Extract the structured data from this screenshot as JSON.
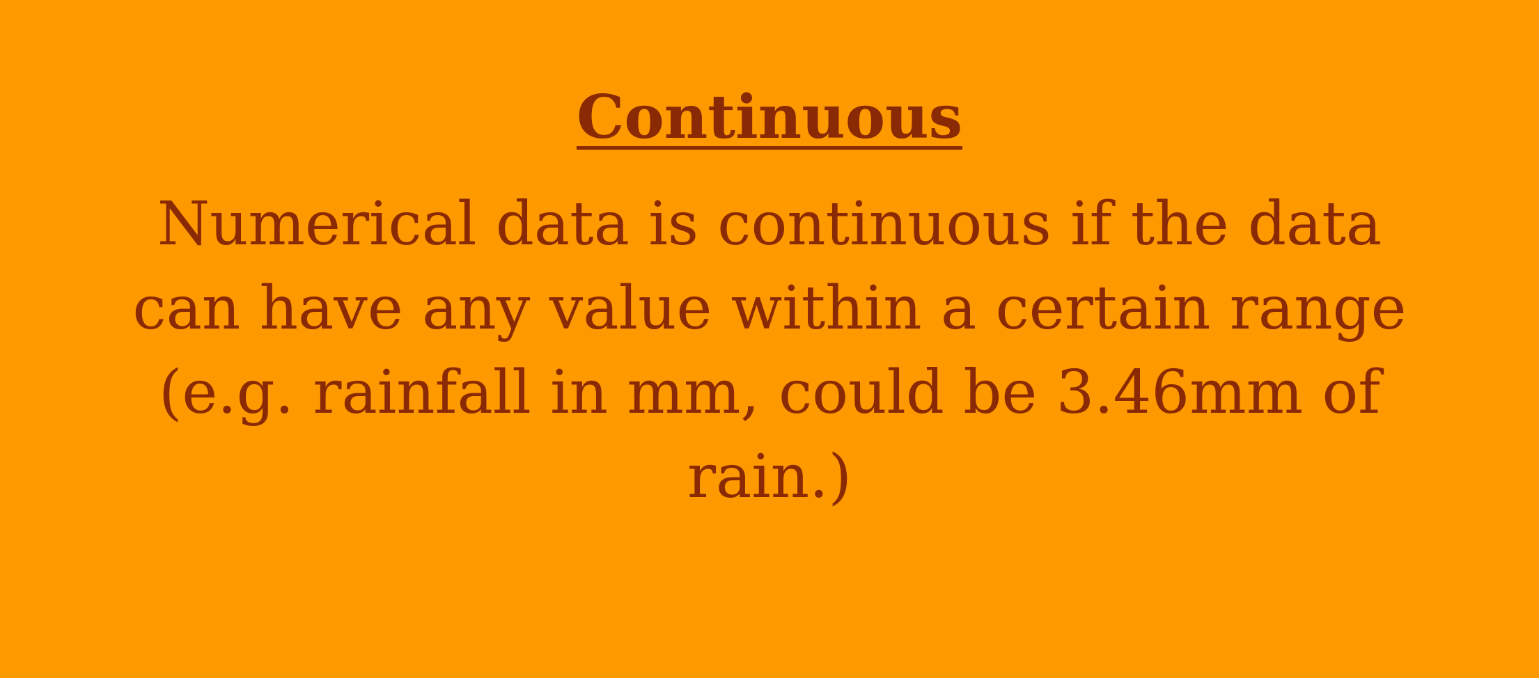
{
  "slide": {
    "title": "Continuous",
    "body": "Numerical data is continuous if the data can have any value within a certain range (e.g. rainfall in mm, could be 3.46mm of rain.)",
    "colors": {
      "background": "#ff9900",
      "text": "#8a2a04"
    }
  }
}
